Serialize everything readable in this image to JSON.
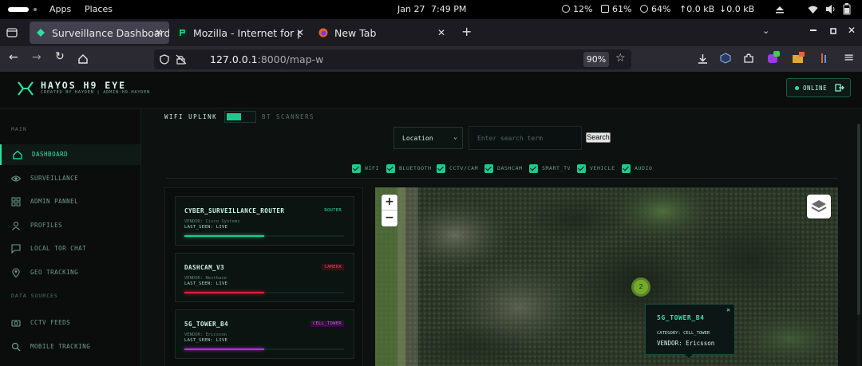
{
  "os_bar": {
    "apps": "Apps",
    "places": "Places",
    "date": "Jan 27",
    "time": "7:49 PM",
    "cpu": "12%",
    "mem": "61%",
    "battery": "64%",
    "net_up": "↑0.0 kB",
    "net_down": "↓0.0 kB"
  },
  "browser": {
    "tabs": [
      {
        "label": "Surveillance Dashboard",
        "active": true
      },
      {
        "label": "Mozilla - Internet for peo",
        "active": false
      },
      {
        "label": "New Tab",
        "active": false
      }
    ],
    "url_host": "127.0.0.1",
    "url_rest": ":8000/map-w",
    "zoom": "90%"
  },
  "app": {
    "brand_title": "HAYOS H9 EYE",
    "brand_sub": "CREATED BY HAYDEN | ADMIN:H9.HAYDEN",
    "status": "ONLINE",
    "sidebar": {
      "section_main": "MAIN",
      "section_data": "DATA SOURCES",
      "items": [
        {
          "label": "DASHBOARD",
          "icon": "home-icon",
          "active": true
        },
        {
          "label": "SURVEILLANCE",
          "icon": "eye-icon"
        },
        {
          "label": "ADMIN PANNEL",
          "icon": "grid-icon"
        },
        {
          "label": "PROFILES",
          "icon": "user-icon"
        },
        {
          "label": "LOCAL TOR CHAT",
          "icon": "chat-icon"
        },
        {
          "label": "GEO TRACKING",
          "icon": "location-pin-icon"
        },
        {
          "label": "CCTV FEEDS",
          "icon": "camera-icon"
        },
        {
          "label": "MOBILE TRACKING",
          "icon": "search-icon"
        }
      ]
    },
    "toggles": {
      "left": "WIFI UPLINK",
      "right": "BT SCANNERS",
      "state": "wifi"
    },
    "search": {
      "select_value": "Location",
      "placeholder": "Enter search term",
      "button": "Search"
    },
    "filters": [
      "WIFI",
      "BLUETOOTH",
      "CCTV/CAM",
      "DASHCAM",
      "SMART_TV",
      "VEHICLE",
      "AUDIO"
    ],
    "devices": [
      {
        "name": "CYBER_SURVEILLANCE_ROUTER",
        "badge": "ROUTER",
        "vendor": "VENDOR: Cisco Systems",
        "seen": "LAST_SEEN: LIVE",
        "level": 0.5,
        "color": "#21c88e"
      },
      {
        "name": "DASHCAM_V3",
        "badge": "CAMERA",
        "vendor": "VENDOR: Nextbase",
        "seen": "LAST_SEEN: LIVE",
        "level": 0.5,
        "color": "#d5263b"
      },
      {
        "name": "5G_TOWER_B4",
        "badge": "CELL_TOWER",
        "vendor": "VENDOR: Ericsson",
        "seen": "LAST_SEEN: LIVE",
        "level": 0.5,
        "color": "#c42ad4"
      }
    ],
    "map": {
      "cluster_count": "2",
      "popup": {
        "title": "5G_TOWER_B4",
        "category": "CATEGORY: CELL_TOWER",
        "vendor": "VENDOR: Ericsson"
      }
    }
  }
}
